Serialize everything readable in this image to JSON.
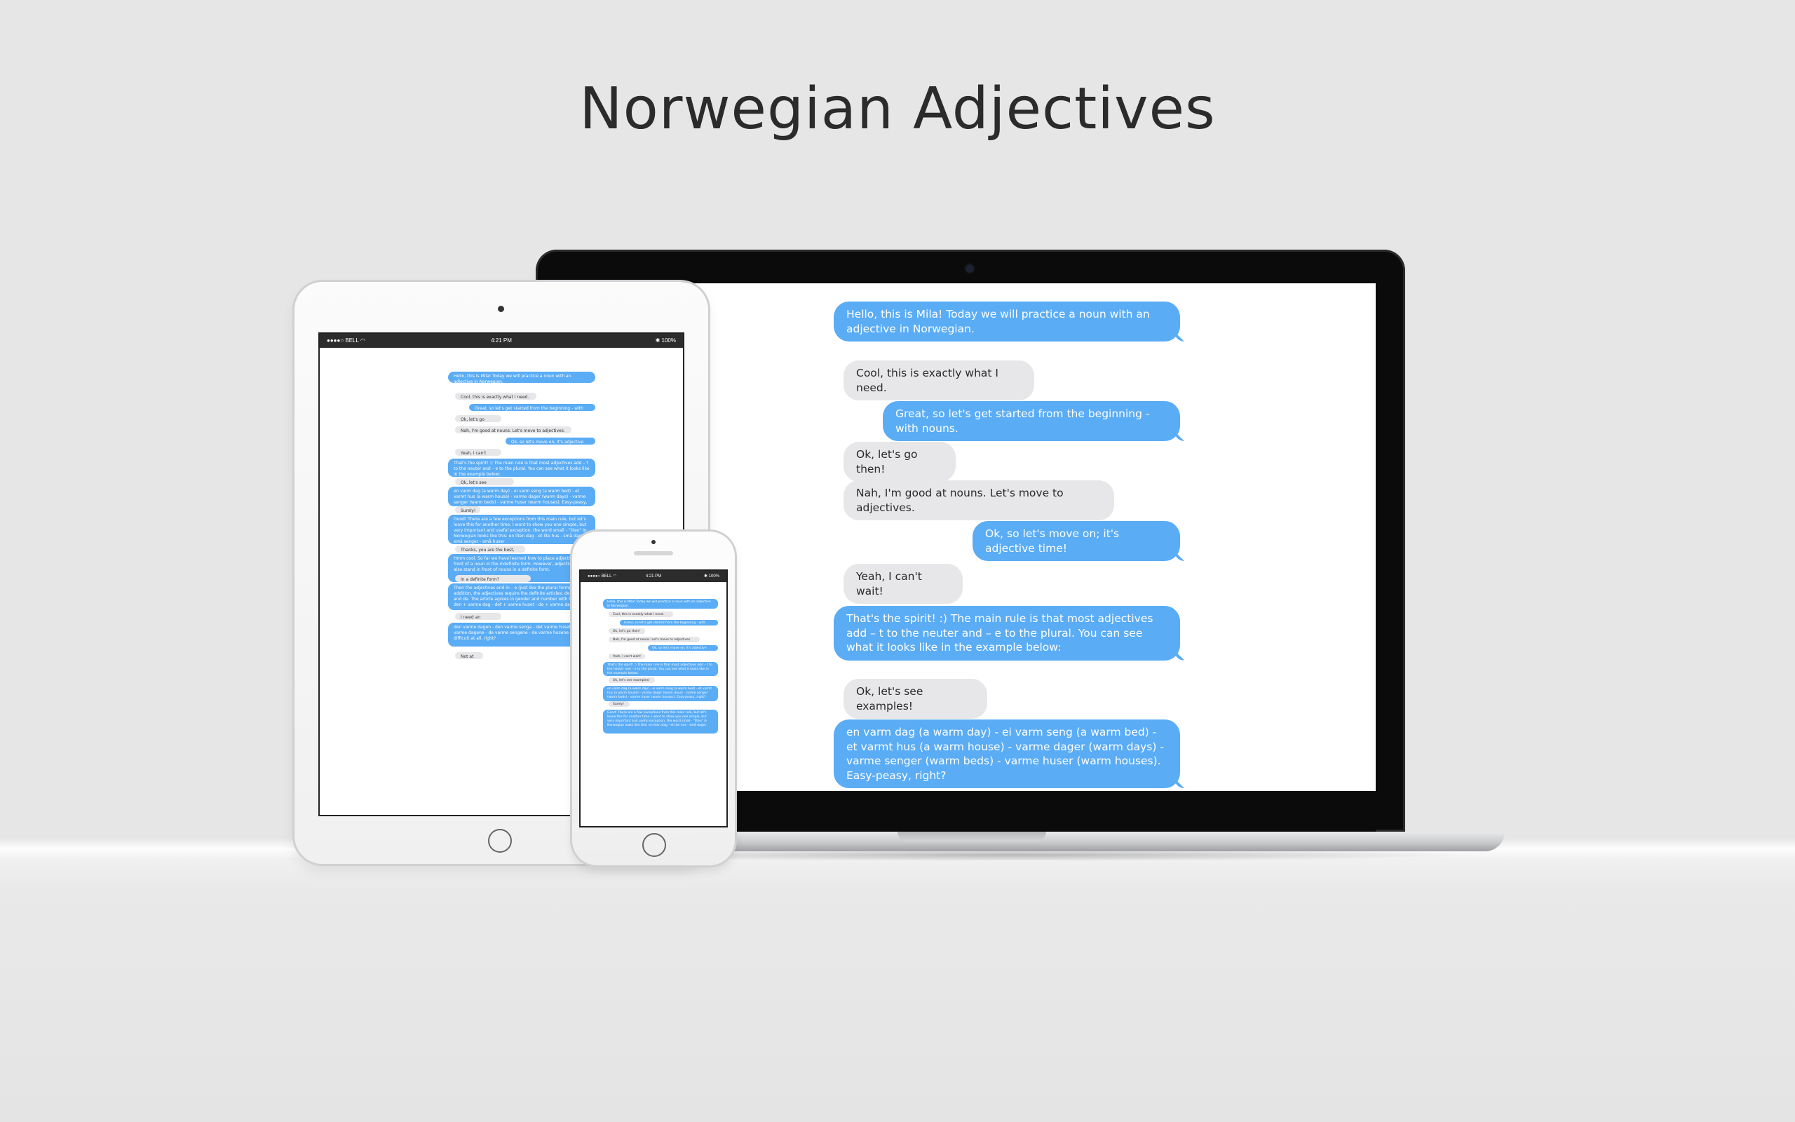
{
  "page": {
    "title": "Norwegian Adjectives"
  },
  "status_bar": {
    "carrier": "●●●●○ BELL ◠",
    "time": "4:21 PM",
    "battery": "✱ 100%"
  },
  "colors": {
    "outgoing": "#5aacf5",
    "incoming": "#e7e7ea",
    "background": "#e6e6e6"
  },
  "laptop_chat": [
    {
      "from": "bot",
      "text": "Hello, this is Mila! Today we will practice a noun with an adjective in Norwegian."
    },
    {
      "from": "user",
      "text": "Cool, this is exactly what I need."
    },
    {
      "from": "bot",
      "text": "Great, so let's get started from the beginning - with nouns."
    },
    {
      "from": "user",
      "text": "Ok, let's go then!"
    },
    {
      "from": "user",
      "text": "Nah, I'm good at nouns. Let's move to adjectives."
    },
    {
      "from": "bot",
      "text": "Ok, so let's move on; it's adjective time!"
    },
    {
      "from": "user",
      "text": "Yeah, I can't wait!"
    },
    {
      "from": "bot",
      "text": "That's the spirit! :) The main rule is that most adjectives add – t to the neuter and – e to the plural. You can see what it looks like in the example below:"
    },
    {
      "from": "user",
      "text": "Ok, let's see examples!"
    },
    {
      "from": "bot",
      "text": "en varm dag (a warm day) - ei varm seng (a warm bed) - et varmt hus (a warm house) - varme dager (warm days) - varme senger (warm beds) - varme huser (warm houses). Easy-peasy, right?"
    }
  ],
  "tablet_chat": [
    {
      "from": "bot",
      "text": "Hello, this is Mila! Today we will practice a noun with an adjective in Norwegian."
    },
    {
      "from": "user",
      "text": "Cool, this is exactly what I need."
    },
    {
      "from": "bot",
      "text": "Great, so let's get started from the beginning - with nouns."
    },
    {
      "from": "user",
      "text": "Ok, let's go then!"
    },
    {
      "from": "user",
      "text": "Nah, I'm good at nouns. Let's move to adjectives."
    },
    {
      "from": "bot",
      "text": "Ok, so let's move on; it's adjective time!"
    },
    {
      "from": "user",
      "text": "Yeah, I can't wait!"
    },
    {
      "from": "bot",
      "text": "That's the spirit! :) The main rule is that most adjectives add – t to the neuter and – e to the plural. You can see what it looks like in the example below:"
    },
    {
      "from": "user",
      "text": "Ok, let's see examples!"
    },
    {
      "from": "bot",
      "text": "en varm dag (a warm day) - ei varm seng (a warm bed) - et varmt hus (a warm house) - varme dager (warm days) - varme senger (warm beds) - varme huser (warm houses). Easy-peasy, right?"
    },
    {
      "from": "user",
      "text": "Surely!"
    },
    {
      "from": "bot",
      "text": "Good! There are a few exceptions from this main rule, but let's leave this for another time. I want to show you one simple, but very important and useful exception: the word small - \"liten\" in Norwegian looks like this: en liten dag - et lite hus - små dager - små senger - små huser"
    },
    {
      "from": "user",
      "text": "Thanks, you are the best, Mila!"
    },
    {
      "from": "bot",
      "text": "Hmm cool. So far we have learned how to place adjectives in front of a noun in the indefinite form. However, adjectives can also stand in front of nouns in a definite form."
    },
    {
      "from": "user",
      "text": "In a definite form? Interesting..."
    },
    {
      "from": "bot",
      "text": "Then the adjectives end in – e (just like the plural form). In addition, the adjectives require the definite articles: den, det and de. The article agrees in gender and number with the noun: den + varme dag - det + varme huset - de + varme dagene"
    },
    {
      "from": "user",
      "text": "I need an example"
    },
    {
      "from": "bot",
      "text": "den varme dagen - den varme senga - det varme huset - de varme dagene - de varme sengene - de varme husene. It's not difficult at all, right?"
    },
    {
      "from": "user",
      "text": "Not at all."
    }
  ],
  "phone_chat": [
    {
      "from": "bot",
      "text": "Hello, this is Mila! Today we will practice a noun with an adjective in Norwegian."
    },
    {
      "from": "user",
      "text": "Cool, this is exactly what I need."
    },
    {
      "from": "bot",
      "text": "Great, so let's get started from the beginning - with nouns."
    },
    {
      "from": "user",
      "text": "Ok, let's go then!"
    },
    {
      "from": "user",
      "text": "Nah, I'm good at nouns. Let's move to adjectives."
    },
    {
      "from": "bot",
      "text": "Ok, so let's move on; it's adjective time!"
    },
    {
      "from": "user",
      "text": "Yeah, I can't wait!"
    },
    {
      "from": "bot",
      "text": "That's the spirit! :) The main rule is that most adjectives add – t to the neuter and – e to the plural. You can see what it looks like in the example below:"
    },
    {
      "from": "user",
      "text": "Ok, let's see examples!"
    },
    {
      "from": "bot",
      "text": "en varm dag (a warm day) - ei varm seng (a warm bed) - et varmt hus (a warm house) - varme dager (warm days) - varme senger (warm beds) - varme huser (warm houses). Easy-peasy, right?"
    },
    {
      "from": "user",
      "text": "Surely!"
    },
    {
      "from": "bot",
      "text": "Good! There are a few exceptions from this main rule, but let's leave this for another time. I want to show you one simple, but very important and useful exception: the word small - \"liten\" in Norwegian looks like this: en liten dag - et lite hus - små dager"
    }
  ]
}
